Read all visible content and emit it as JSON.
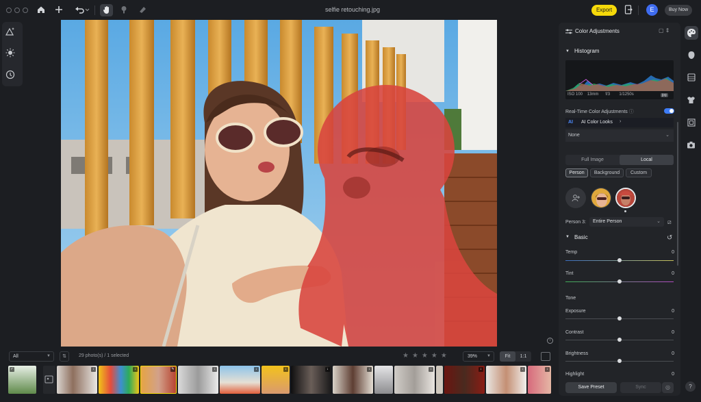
{
  "window": {
    "title": "selfie retouching.jpg"
  },
  "toolbar": {
    "home_icon": "home-icon",
    "add_icon": "plus-icon",
    "undo_icon": "undo-icon",
    "export_label": "Export",
    "avatar_letter": "E",
    "buy_label": "Buy Now"
  },
  "filmstrip": {
    "filter_value": "All",
    "count_text": "29 photo(s) / 1 selected",
    "zoom_value": "39%",
    "fit_label": "Fit",
    "one_to_one_label": "1:1",
    "rating_stars": 5
  },
  "panel": {
    "header": "Color Adjustments",
    "histogram_title": "Histogram",
    "exif": {
      "iso": "ISO 100",
      "focal": "13mm",
      "aperture": "f/3",
      "shutter": "1/1250s",
      "format": "jpg"
    },
    "realtime_label": "Real-Time Color Adjustments",
    "realtime_on": true,
    "ai_looks": {
      "badge": "AI",
      "label": "AI Color Looks"
    },
    "look_value": "None",
    "tabs": [
      "Full Image",
      "Local"
    ],
    "active_tab": "Local",
    "chips": [
      "Person",
      "Background",
      "Custom"
    ],
    "active_chip": "Person",
    "person_label": "Person 3:",
    "person_value": "Entire Person",
    "basic_title": "Basic",
    "sliders_basic": [
      {
        "label": "Temp",
        "value": "0"
      },
      {
        "label": "Tint",
        "value": "0"
      }
    ],
    "tone_label": "Tone",
    "sliders_tone": [
      {
        "label": "Exposure",
        "value": "0"
      },
      {
        "label": "Contrast",
        "value": "0"
      },
      {
        "label": "Brightness",
        "value": "0"
      },
      {
        "label": "Highlight",
        "value": "0"
      }
    ],
    "save_preset_label": "Save Preset",
    "sync_label": "Sync"
  },
  "colors": {
    "accent_yellow": "#f5d90a",
    "accent_blue": "#3e7cf5",
    "mask_red": "#d9453e",
    "bg": "#1c1e22"
  }
}
